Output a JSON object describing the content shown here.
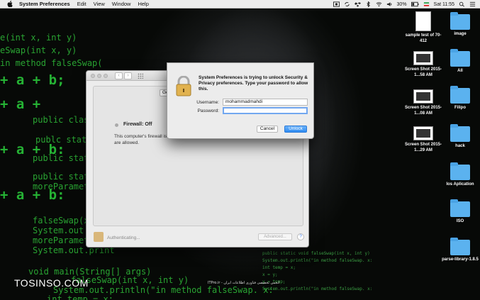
{
  "menubar": {
    "app_name": "System Preferences",
    "items": [
      "Edit",
      "View",
      "Window",
      "Help"
    ],
    "battery": "30%",
    "clock": "Sat 11:55"
  },
  "desktop_icons": [
    {
      "label": "sample test of 70-412",
      "kind": "document"
    },
    {
      "label": "image",
      "kind": "folder"
    },
    {
      "label": "Screen Shot 2015-1...58 AM",
      "kind": "screenshot"
    },
    {
      "label": "All",
      "kind": "folder"
    },
    {
      "label": "Screen Shot 2015-1...08 AM",
      "kind": "screenshot"
    },
    {
      "label": "Filipo",
      "kind": "folder"
    },
    {
      "label": "Screen Shot 2015-1...29 AM",
      "kind": "screenshot"
    },
    {
      "label": "hack",
      "kind": "folder"
    },
    {
      "label": "Ios Aplication",
      "kind": "folder"
    },
    {
      "label": "ISO",
      "kind": "folder"
    },
    {
      "label": "parse-library-1.8.5",
      "kind": "folder"
    }
  ],
  "prefs_window": {
    "tab_general": "Gene",
    "firewall_status": "Firewall: Off",
    "firewall_description": "This computer's firewall is cu computer are allowed.",
    "authenticating_text": "Authenticating...",
    "advanced_button": "Advanced...",
    "help_button": "?"
  },
  "auth_dialog": {
    "message": "System Preferences is trying to unlock Security & Privacy preferences. Type your password to allow this.",
    "username_label": "Username:",
    "username_value": "mohammadmahdi",
    "password_label": "Password:",
    "password_value": "",
    "cancel_label": "Cancel",
    "unlock_label": "Unlock"
  },
  "background_code": {
    "left_lines": [
      "e(int x, int y)",
      "eSwap(int x, y)",
      "in method falseSwap(",
      "+ a + b;",
      "+ a +",
      "+ a + b;",
      "public class Prim",
      "publc stat",
      "+ a + b:",
      "+ a + b:",
      "+ a + b:",
      "public static void",
      "public static void",
      "moreParameter",
      "moreParameters(",
      "falseSwap(x,y);",
      "System.out.print",
      "moreParameters(x",
      "System.out.print",
      "void main(String[] args)",
      "falseSwap(int x, int y)",
      "System.out.println(\"in method falseSwap. x:",
      "int temp = x;"
    ],
    "right_lines": [
      "public static void falseSwap(int x, int y)",
      "System.out.println(\"in method falseSwap. x:",
      "int temp = x;",
      "x = y;",
      "y = temp;",
      "System.out.println(\"in method falseSwap. x:"
    ]
  },
  "watermark": "TOSINSO.COM",
  "caption": "ITPro.ir - انجمن تخصصی فناوری اطلاعات ایران"
}
